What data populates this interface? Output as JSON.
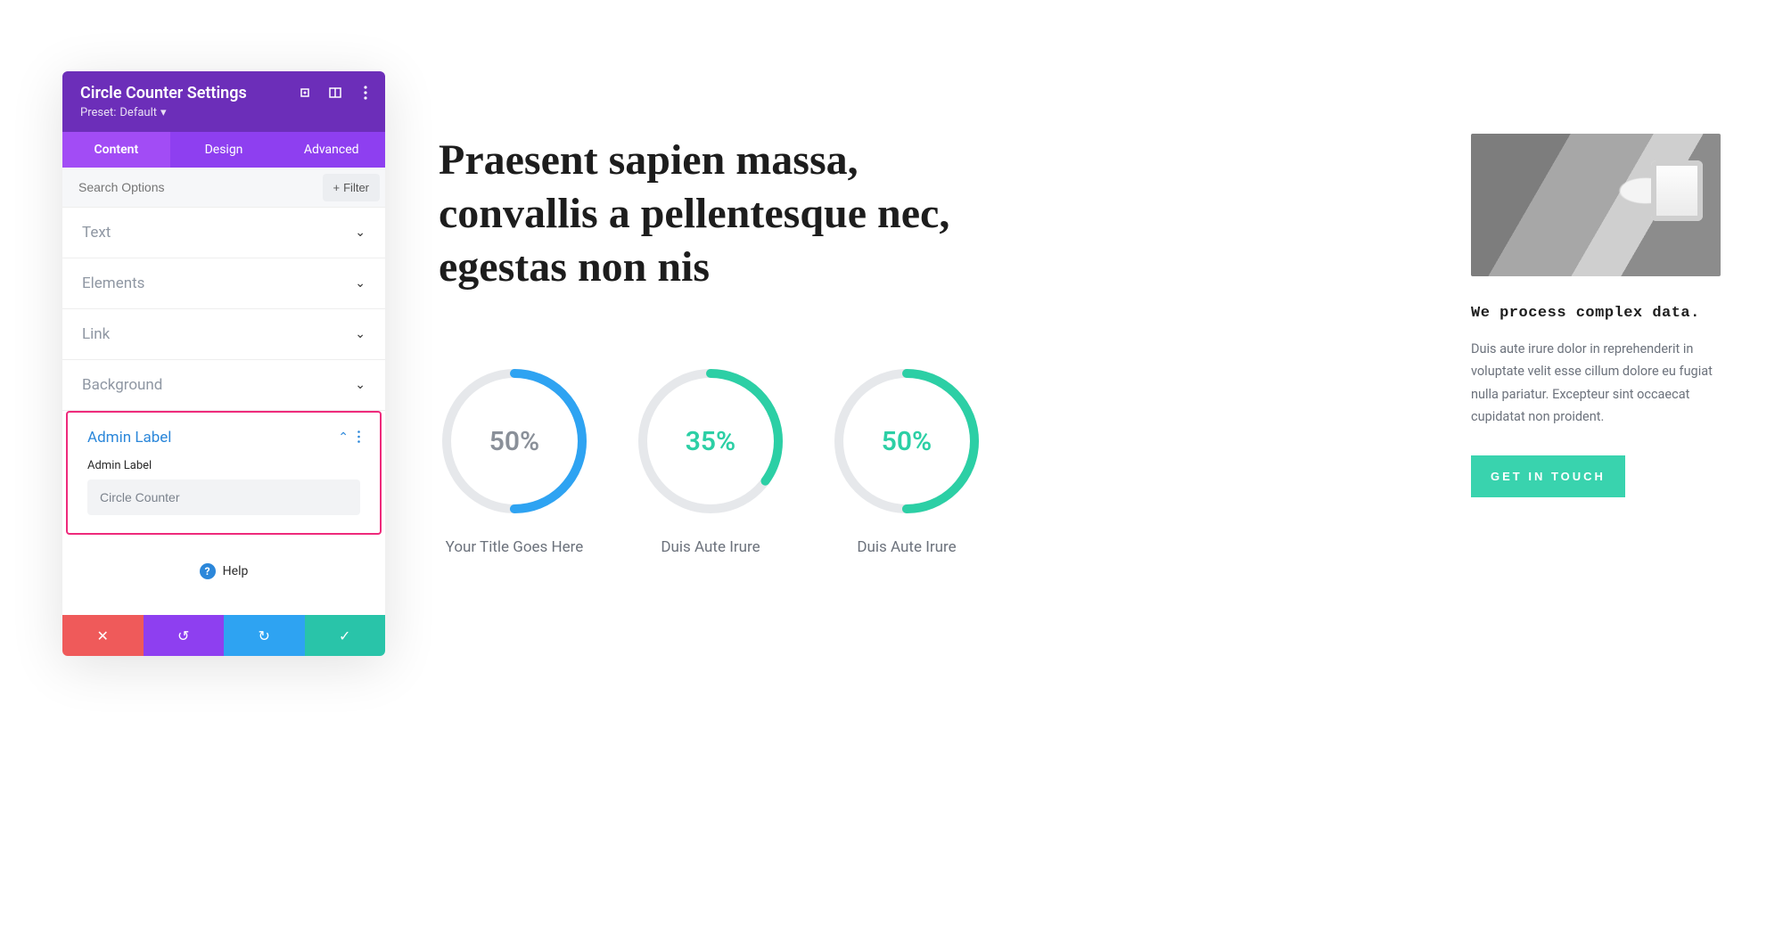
{
  "panel": {
    "title": "Circle Counter Settings",
    "preset_prefix": "Preset: ",
    "preset_value": "Default",
    "tabs": [
      "Content",
      "Design",
      "Advanced"
    ],
    "active_tab": 0,
    "search_placeholder": "Search Options",
    "filter_label": "Filter",
    "sections": [
      "Text",
      "Elements",
      "Link",
      "Background"
    ],
    "admin": {
      "heading": "Admin Label",
      "field_label": "Admin Label",
      "field_value": "Circle Counter"
    },
    "help_label": "Help"
  },
  "content": {
    "heading": "Praesent sapien massa, convallis a pellentesque nec, egestas non nis",
    "counters": [
      {
        "percent": 50,
        "label": "50%",
        "title": "Your Title Goes Here",
        "color": "#2ea3f2",
        "text": "gray"
      },
      {
        "percent": 35,
        "label": "35%",
        "title": "Duis Aute Irure",
        "color": "#2ccfa5",
        "text": "teal"
      },
      {
        "percent": 50,
        "label": "50%",
        "title": "Duis Aute Irure",
        "color": "#2ccfa5",
        "text": "teal"
      }
    ]
  },
  "right": {
    "mono_title": "We process complex data.",
    "paragraph": "Duis aute irure dolor in reprehenderit in voluptate velit esse cillum dolore eu fugiat nulla pariatur. Excepteur sint occaecat cupidatat non proident.",
    "cta": "GET IN TOUCH"
  },
  "chart_data": [
    {
      "type": "pie",
      "title": "Your Title Goes Here",
      "values": [
        50,
        50
      ],
      "categories": [
        "filled",
        "remaining"
      ],
      "ylim": [
        0,
        100
      ]
    },
    {
      "type": "pie",
      "title": "Duis Aute Irure",
      "values": [
        35,
        65
      ],
      "categories": [
        "filled",
        "remaining"
      ],
      "ylim": [
        0,
        100
      ]
    },
    {
      "type": "pie",
      "title": "Duis Aute Irure",
      "values": [
        50,
        50
      ],
      "categories": [
        "filled",
        "remaining"
      ],
      "ylim": [
        0,
        100
      ]
    }
  ]
}
